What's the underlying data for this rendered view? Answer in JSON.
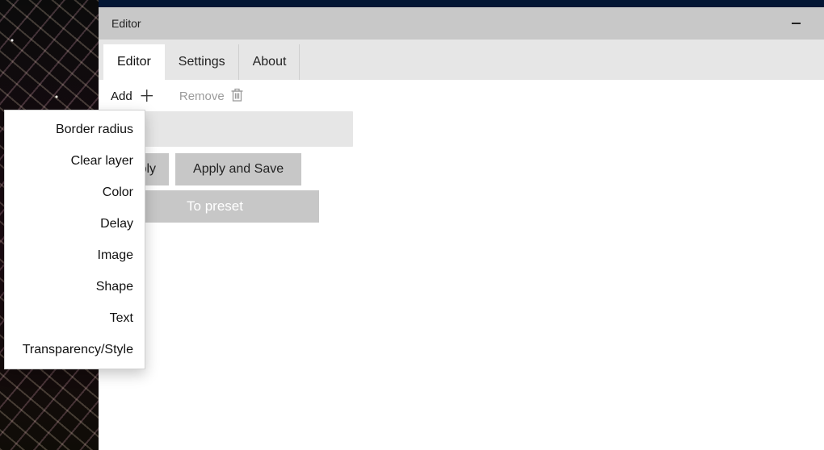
{
  "window": {
    "title": "Editor"
  },
  "tabs": {
    "editor": "Editor",
    "settings": "Settings",
    "about": "About"
  },
  "toolbar": {
    "add_label": "Add",
    "remove_label": "Remove"
  },
  "actions": {
    "apply": "Apply",
    "apply_save": "Apply and Save",
    "to_preset": "To preset"
  },
  "add_menu": {
    "items": [
      "Border radius",
      "Clear layer",
      "Color",
      "Delay",
      "Image",
      "Shape",
      "Text",
      "Transparency/Style"
    ]
  }
}
